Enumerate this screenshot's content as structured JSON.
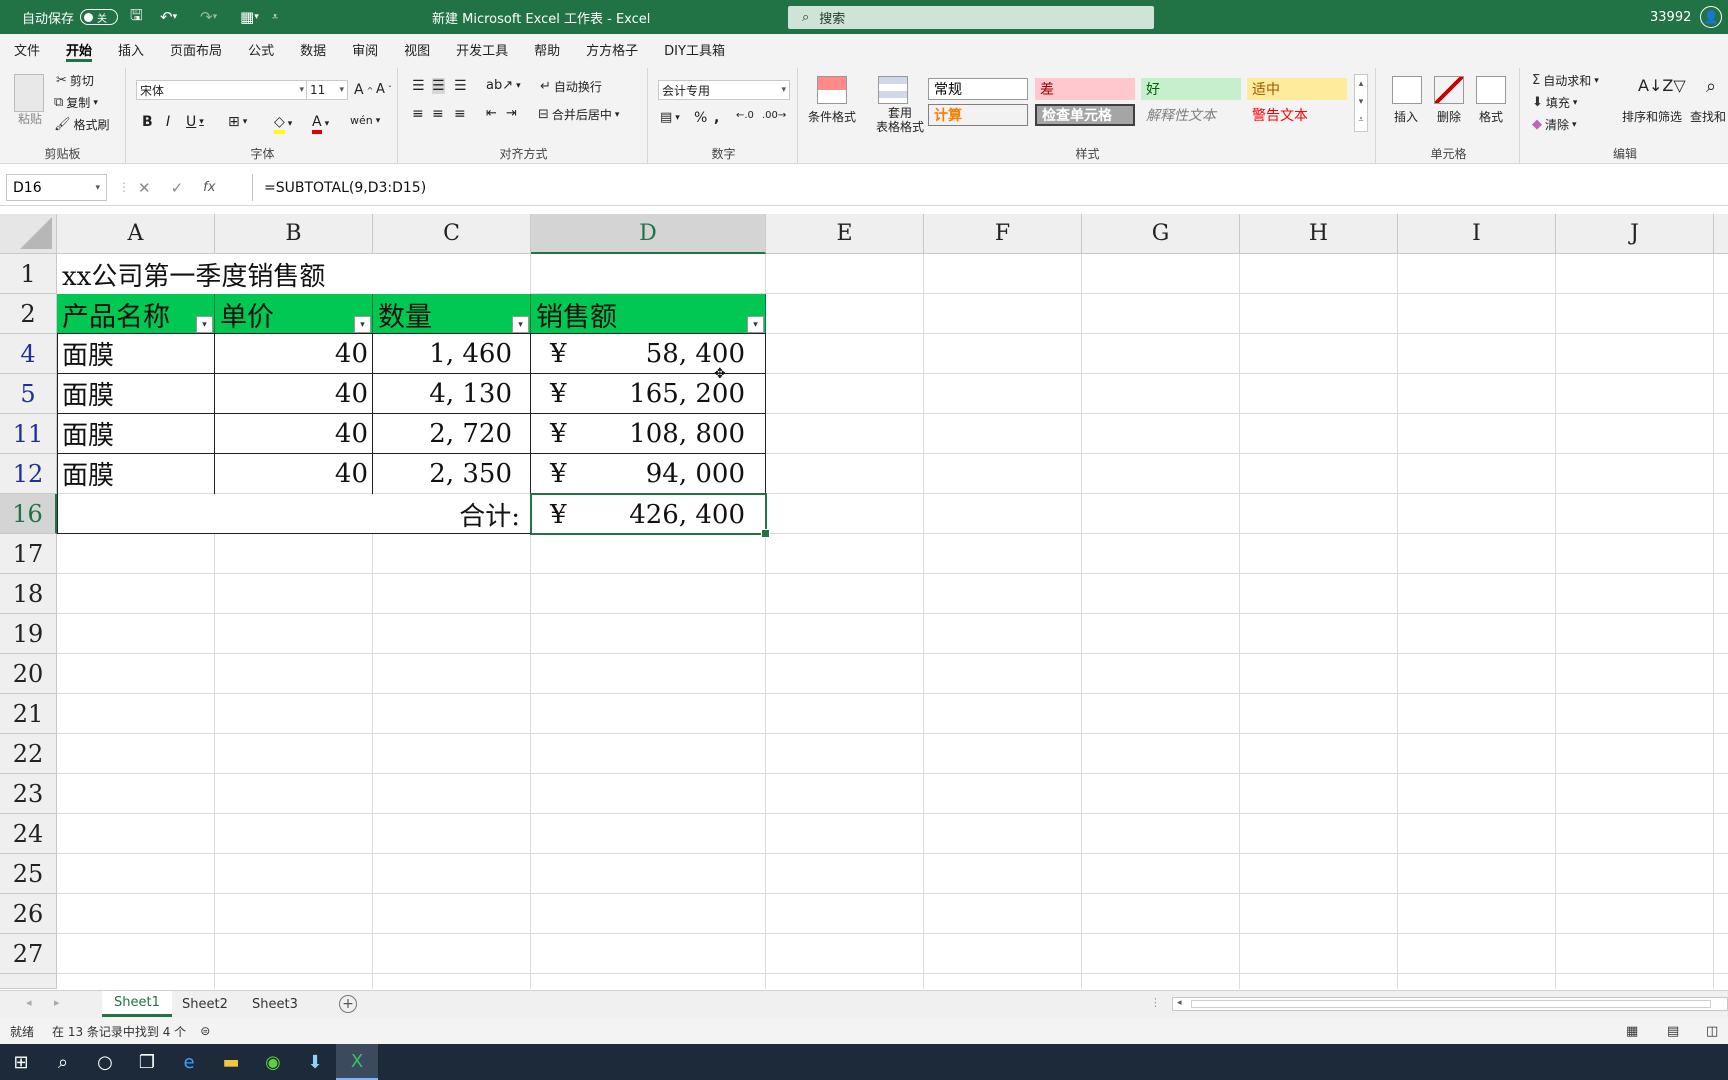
{
  "titlebar": {
    "autosave_label": "自动保存",
    "autosave_state": "关",
    "doc_title": "新建 Microsoft Excel 工作表  -  Excel",
    "search_placeholder": "搜索",
    "user": "33992"
  },
  "ribbon_tabs": [
    "文件",
    "开始",
    "插入",
    "页面布局",
    "公式",
    "数据",
    "审阅",
    "视图",
    "开发工具",
    "帮助",
    "方方格子",
    "DIY工具箱"
  ],
  "ribbon": {
    "clipboard": {
      "paste": "粘贴",
      "cut": "剪切",
      "copy": "复制",
      "format_painter": "格式刷",
      "label": "剪贴板"
    },
    "font": {
      "name": "宋体",
      "size": "11",
      "label": "字体"
    },
    "alignment": {
      "wrap": "自动换行",
      "merge": "合并后居中",
      "label": "对齐方式"
    },
    "number": {
      "format": "会计专用",
      "label": "数字"
    },
    "styles": {
      "conditional": "条件格式",
      "table_format": "套用\n表格格式",
      "cells": [
        "常规",
        "差",
        "好",
        "适中",
        "计算",
        "检查单元格",
        "解释性文本",
        "警告文本"
      ],
      "label": "样式"
    },
    "cells_group": {
      "insert": "插入",
      "delete": "删除",
      "format": "格式",
      "label": "单元格"
    },
    "editing": {
      "autosum": "自动求和",
      "fill": "填充",
      "clear": "清除",
      "sort": "排序和筛选",
      "find": "查找和",
      "label": "编辑"
    }
  },
  "formula_bar": {
    "name_box": "D16",
    "fx": "fx",
    "formula": "=SUBTOTAL(9,D3:D15)"
  },
  "sheet": {
    "columns": [
      "A",
      "B",
      "C",
      "D",
      "E",
      "F",
      "G",
      "H",
      "I",
      "J"
    ],
    "rows": [
      "1",
      "2",
      "4",
      "5",
      "11",
      "12",
      "16",
      "17",
      "18",
      "19",
      "20",
      "21",
      "22",
      "23",
      "24",
      "25",
      "26",
      "27"
    ],
    "title": "xx公司第一季度销售额",
    "headers": [
      "产品名称",
      "单价",
      "数量",
      "销售额"
    ],
    "data": [
      {
        "name": "面膜",
        "price": "40",
        "qty": "1, 460",
        "cur": "¥",
        "amount": "58, 400"
      },
      {
        "name": "面膜",
        "price": "40",
        "qty": "4, 130",
        "cur": "¥",
        "amount": "165, 200"
      },
      {
        "name": "面膜",
        "price": "40",
        "qty": "2, 720",
        "cur": "¥",
        "amount": "108, 800"
      },
      {
        "name": "面膜",
        "price": "40",
        "qty": "2, 350",
        "cur": "¥",
        "amount": "94, 000"
      }
    ],
    "total_label": "合计:",
    "total_cur": "¥",
    "total_amount": "426, 400"
  },
  "sheet_tabs": [
    "Sheet1",
    "Sheet2",
    "Sheet3"
  ],
  "status": {
    "ready": "就绪",
    "filter_info": "在 13 条记录中找到 4 个"
  },
  "colors": {
    "excel_green": "#217346",
    "header_green": "#00c853"
  }
}
